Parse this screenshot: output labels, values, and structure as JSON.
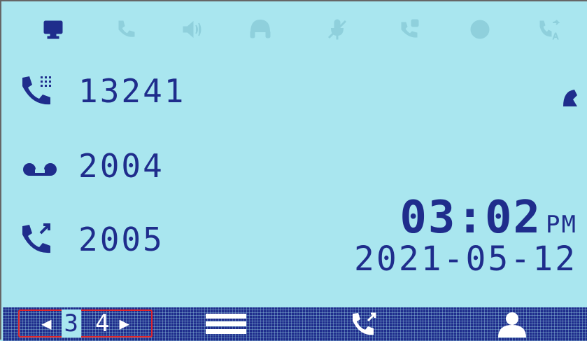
{
  "status_bar": {
    "icons": [
      "network-icon",
      "phone-icon",
      "speaker-icon",
      "headset-icon",
      "mute-icon",
      "call-forward-icon",
      "dnd-icon",
      "auto-answer-icon"
    ],
    "active_icon": "network-icon"
  },
  "lines": [
    {
      "icon": "voicemail-dial-icon",
      "number": "13241"
    },
    {
      "icon": "voicemail-icon",
      "number": "2004"
    },
    {
      "icon": "call-transfer-icon",
      "number": "2005"
    }
  ],
  "clock": {
    "time": "03:02",
    "ampm": "PM",
    "date": "2021-05-12"
  },
  "softkeys": {
    "pager_left_arrow": "◀",
    "page_current": "3",
    "page_next": "4",
    "pager_right_arrow": "▶"
  },
  "colors": {
    "lcd_background": "#a9e6ef",
    "lcd_foreground": "#1f2d8c",
    "highlight_border": "#e0242a"
  }
}
